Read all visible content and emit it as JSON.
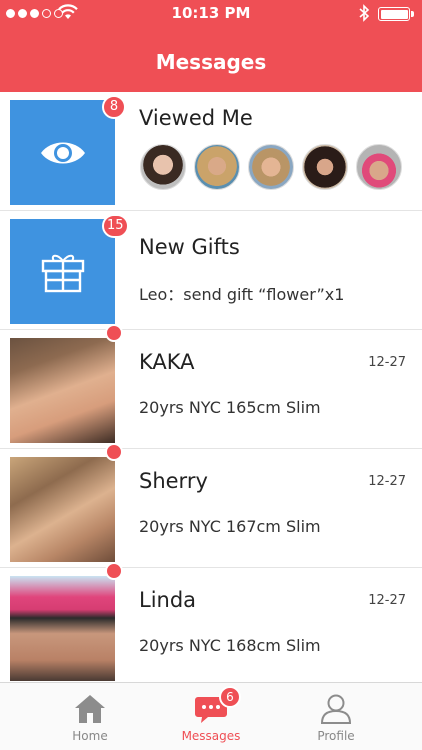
{
  "status_bar": {
    "time": "10:13 PM"
  },
  "header": {
    "title": "Messages"
  },
  "viewed": {
    "title": "Viewed Me",
    "badge": "8"
  },
  "gifts": {
    "title": "New Gifts",
    "badge": "15",
    "subtitle": "Leo：send gift “flower”x1"
  },
  "messages": [
    {
      "name": "KAKA",
      "date": "12-27",
      "info": "20yrs  NYC  165cm  Slim"
    },
    {
      "name": "Sherry",
      "date": "12-27",
      "info": "20yrs  NYC  167cm  Slim"
    },
    {
      "name": "Linda",
      "date": "12-27",
      "info": "20yrs  NYC  168cm  Slim"
    }
  ],
  "tabs": [
    {
      "label": "Home",
      "icon": "home-icon"
    },
    {
      "label": "Messages",
      "icon": "chat-icon",
      "badge": "6"
    },
    {
      "label": "Profile",
      "icon": "person-icon"
    }
  ],
  "colors": {
    "accent": "#ef4f55",
    "tile": "#3f93e0"
  }
}
